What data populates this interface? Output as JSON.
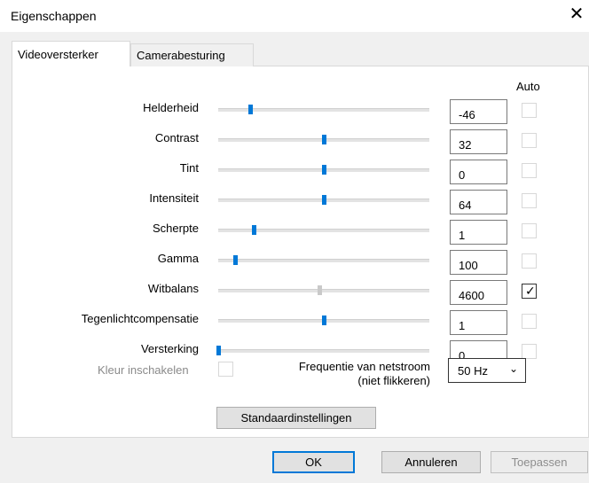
{
  "window": {
    "title": "Eigenschappen",
    "close_label": "✕"
  },
  "tabs": [
    {
      "label": "Videoversterker",
      "active": true
    },
    {
      "label": "Camerabesturing",
      "active": false
    }
  ],
  "auto_header": "Auto",
  "properties": [
    {
      "label": "Helderheid",
      "value": "-46",
      "level": 0.15,
      "auto": false,
      "auto_enabled": false,
      "slider_enabled": true
    },
    {
      "label": "Contrast",
      "value": "32",
      "level": 0.5,
      "auto": false,
      "auto_enabled": false,
      "slider_enabled": true
    },
    {
      "label": "Tint",
      "value": "0",
      "level": 0.5,
      "auto": false,
      "auto_enabled": false,
      "slider_enabled": true
    },
    {
      "label": "Intensiteit",
      "value": "64",
      "level": 0.5,
      "auto": false,
      "auto_enabled": false,
      "slider_enabled": true
    },
    {
      "label": "Scherpte",
      "value": "1",
      "level": 0.17,
      "auto": false,
      "auto_enabled": false,
      "slider_enabled": true
    },
    {
      "label": "Gamma",
      "value": "100",
      "level": 0.08,
      "auto": false,
      "auto_enabled": false,
      "slider_enabled": true
    },
    {
      "label": "Witbalans",
      "value": "4600",
      "level": 0.48,
      "auto": true,
      "auto_enabled": true,
      "slider_enabled": false
    },
    {
      "label": "Tegenlichtcompensatie",
      "value": "1",
      "level": 0.5,
      "auto": false,
      "auto_enabled": false,
      "slider_enabled": true
    },
    {
      "label": "Versterking",
      "value": "0",
      "level": 0.0,
      "auto": false,
      "auto_enabled": false,
      "slider_enabled": true
    }
  ],
  "color_enable": {
    "label": "Kleur inschakelen",
    "checked": false
  },
  "frequency": {
    "label_line1": "Frequentie van netstroom",
    "label_line2": "(niet flikkeren)",
    "selected": "50 Hz"
  },
  "buttons": {
    "defaults": "Standaardinstellingen",
    "ok": "OK",
    "cancel": "Annuleren",
    "apply": "Toepassen"
  },
  "colors": {
    "accent": "#0078d7",
    "disabled_thumb": "#c9c9c9"
  }
}
